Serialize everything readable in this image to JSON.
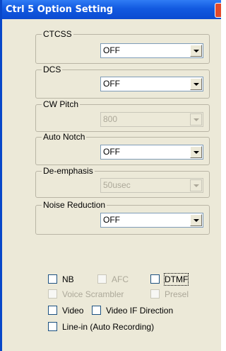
{
  "window": {
    "title": "Ctrl 5 Option Setting"
  },
  "groups": {
    "ctcss": {
      "label": "CTCSS",
      "value": "OFF",
      "enabled": true
    },
    "dcs": {
      "label": "DCS",
      "value": "OFF",
      "enabled": true
    },
    "cw_pitch": {
      "label": "CW Pitch",
      "value": "800",
      "enabled": false
    },
    "auto_notch": {
      "label": "Auto Notch",
      "value": "OFF",
      "enabled": true
    },
    "de_emphasis": {
      "label": "De-emphasis",
      "value": "50usec",
      "enabled": false
    },
    "noise_reduction": {
      "label": "Noise Reduction",
      "value": "OFF",
      "enabled": true
    }
  },
  "checkboxes": {
    "nb": {
      "label": "NB",
      "checked": false,
      "enabled": true
    },
    "afc": {
      "label": "AFC",
      "checked": false,
      "enabled": false
    },
    "dtmf": {
      "label": "DTMF",
      "checked": false,
      "enabled": true
    },
    "voice_scrambler": {
      "label": "Voice Scrambler",
      "checked": false,
      "enabled": false
    },
    "presel": {
      "label": "Presel",
      "checked": false,
      "enabled": false
    },
    "video": {
      "label": "Video",
      "checked": false,
      "enabled": true
    },
    "video_if_direction": {
      "label": "Video IF Direction",
      "checked": false,
      "enabled": true
    },
    "line_in": {
      "label": "Line-in (Auto Recording)",
      "checked": false,
      "enabled": true
    }
  },
  "colors": {
    "titlebar": "#1259e0",
    "window_bg": "#ece9d8",
    "disabled_text": "#aca899"
  }
}
